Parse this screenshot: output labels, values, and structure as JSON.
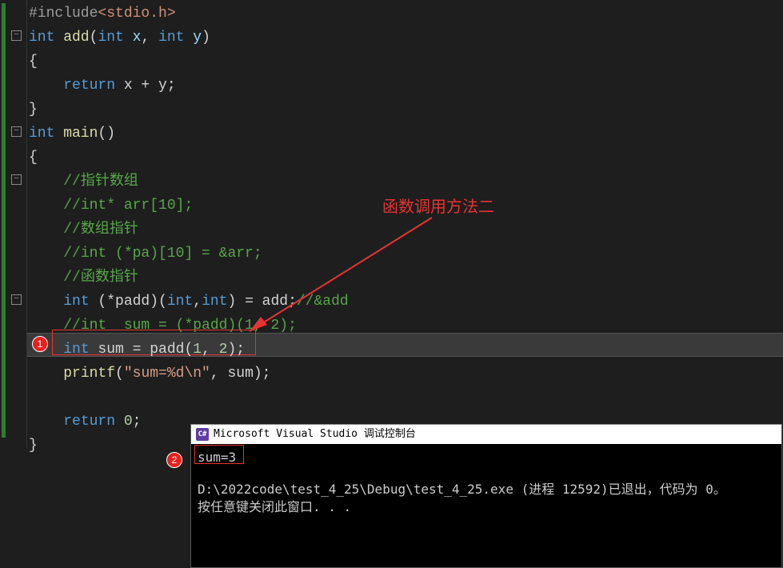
{
  "code": {
    "l1_pre": "#include",
    "l1_hdr": "<stdio.h>",
    "l2_type": "int",
    "l2_func": " add",
    "l2_paren1": "(",
    "l2_p1t": "int",
    "l2_p1n": " x",
    "l2_comma": ", ",
    "l2_p2t": "int",
    "l2_p2n": " y",
    "l2_paren2": ")",
    "l3": "{",
    "l4_kw": "return",
    "l4_expr": " x + y;",
    "l5": "}",
    "l6_type": "int",
    "l6_func": " main",
    "l6_paren": "()",
    "l7": "{",
    "l8_comm": "//指针数组",
    "l9_comm": "//int* arr[10];",
    "l10_comm": "//数组指针",
    "l11_comm": "//int (*pa)[10] = &arr;",
    "l12_comm": "//函数指针",
    "l13_type": "int",
    "l13_mid": " (*padd)(",
    "l13_t1": "int",
    "l13_c": ",",
    "l13_t2": "int",
    "l13_after": ") = add;",
    "l13_comm": "//&add",
    "l14_comm": "//int  sum = (*padd)(1, 2);",
    "l15_type": "int",
    "l15_var": " sum = padd(",
    "l15_n1": "1",
    "l15_c": ", ",
    "l15_n2": "2",
    "l15_end": ");",
    "l16_func": "printf",
    "l16_p1": "(",
    "l16_str": "\"sum=%d\\n\"",
    "l16_rest": ", sum);",
    "l18_kw": "return",
    "l18_sp": " ",
    "l18_n": "0",
    "l18_end": ";",
    "l19": "}"
  },
  "annotation": {
    "label": "函数调用方法二",
    "badge1": "1",
    "badge2": "2"
  },
  "console": {
    "title": "Microsoft Visual Studio 调试控制台",
    "output": "sum=3",
    "exit_line": "D:\\2022code\\test_4_25\\Debug\\test_4_25.exe (进程 12592)已退出，代码为 0。",
    "prompt": "按任意键关闭此窗口. . ."
  },
  "fold_glyph": "−"
}
